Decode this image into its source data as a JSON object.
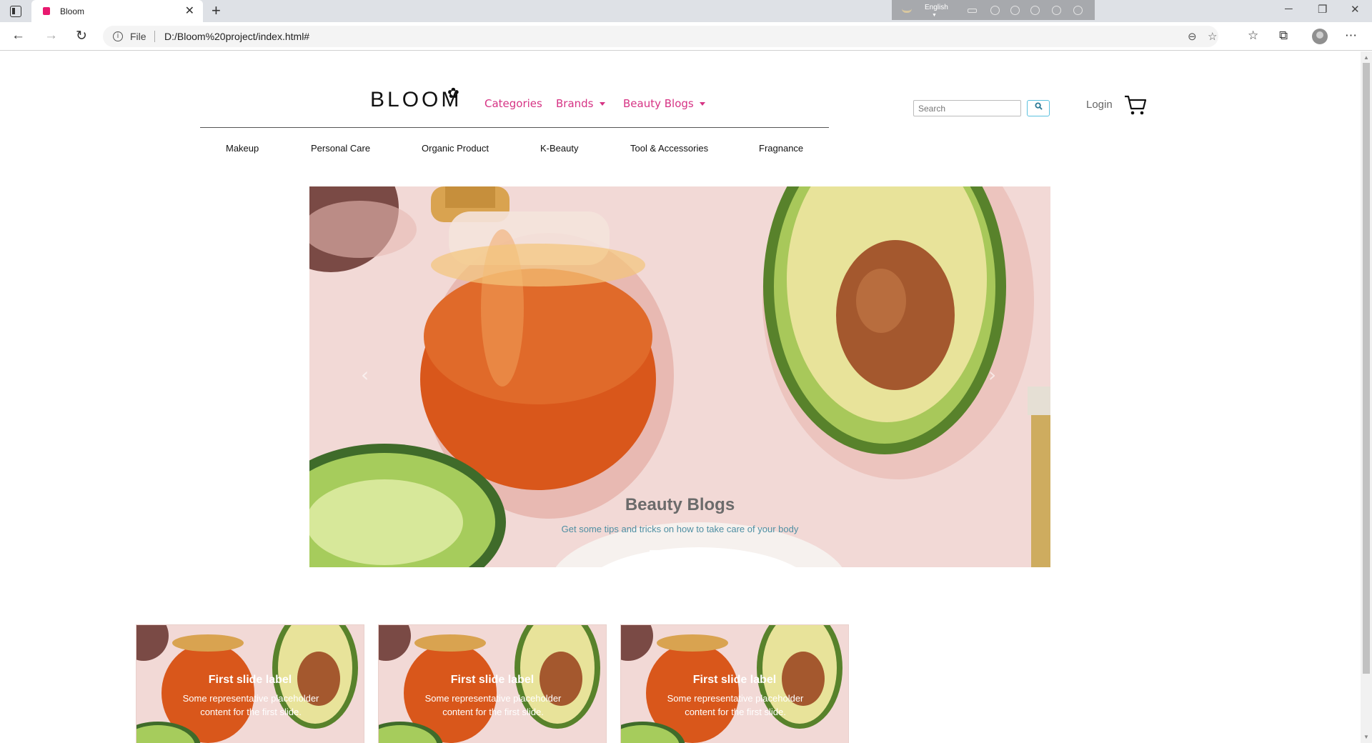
{
  "browser": {
    "tab_title": "Bloom",
    "file_label": "File",
    "url": "D:/Bloom%20project/index.html#",
    "lang_bar_text": "English"
  },
  "site": {
    "nav": {
      "categories": "Categories",
      "brands": "Brands",
      "blogs": "Beauty Blogs"
    },
    "search_placeholder": "Search",
    "login": "Login",
    "categories": [
      "Makeup",
      "Personal Care",
      "Organic Product",
      "K-Beauty",
      "Tool & Accessories",
      "Fragnance"
    ]
  },
  "carousel": {
    "caption_title": "Beauty Blogs",
    "caption_text": "Get some tips and tricks on how to take care of your body",
    "slide_count": 3
  },
  "cards": [
    {
      "title": "First slide label",
      "text": "Some representative placeholder content for the first slide."
    },
    {
      "title": "First slide label",
      "text": "Some representative placeholder content for the first slide."
    },
    {
      "title": "First slide label",
      "text": "Some representative placeholder content for the first slide."
    }
  ],
  "colors": {
    "accent": "#d63384",
    "carousel_bg": "#f2d9d6",
    "honey": "#d9571b",
    "avocado": "#9fc24a",
    "cucumber": "#8fbb4a"
  }
}
